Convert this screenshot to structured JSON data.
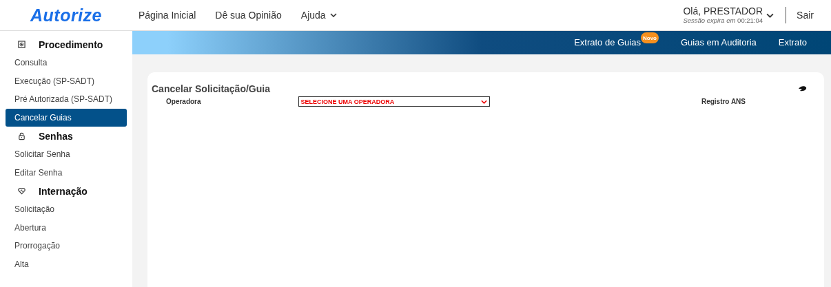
{
  "logo": {
    "text": "Autorize"
  },
  "top_nav": [
    {
      "label": "Página Inicial",
      "dropdown": false
    },
    {
      "label": "Dê sua Opinião",
      "dropdown": false
    },
    {
      "label": "Ajuda",
      "dropdown": true
    }
  ],
  "user": {
    "greeting": "Olá, PRESTADOR",
    "session_label": "Sessão expira em",
    "session_time": "00:21:04",
    "logout": "Sair"
  },
  "sub_nav": [
    {
      "label": "Extrato de Guias",
      "badge": "Novo"
    },
    {
      "label": "Guias em Auditoria"
    },
    {
      "label": "Extrato"
    }
  ],
  "sidebar": [
    {
      "kind": "section",
      "label": "Procedimento"
    },
    {
      "kind": "item",
      "label": "Consulta",
      "selected": false
    },
    {
      "kind": "item",
      "label": "Execução (SP-SADT)",
      "selected": false
    },
    {
      "kind": "item",
      "label": "Pré Autorizada (SP-SADT)",
      "selected": false
    },
    {
      "kind": "item",
      "label": "Cancelar Guias",
      "selected": true
    },
    {
      "kind": "section",
      "label": "Senhas"
    },
    {
      "kind": "item",
      "label": "Solicitar Senha",
      "selected": false
    },
    {
      "kind": "item",
      "label": "Editar Senha",
      "selected": false
    },
    {
      "kind": "section",
      "label": "Internação"
    },
    {
      "kind": "item",
      "label": "Solicitação",
      "selected": false
    },
    {
      "kind": "item",
      "label": "Abertura",
      "selected": false
    },
    {
      "kind": "item",
      "label": "Prorrogação",
      "selected": false
    },
    {
      "kind": "item",
      "label": "Alta",
      "selected": false
    }
  ],
  "form": {
    "title": "Cancelar Solicitação/Guia",
    "operator_label": "Operadora",
    "operator_select": "SELECIONE UMA OPERADORA",
    "ans_label": "Registro ANS"
  }
}
